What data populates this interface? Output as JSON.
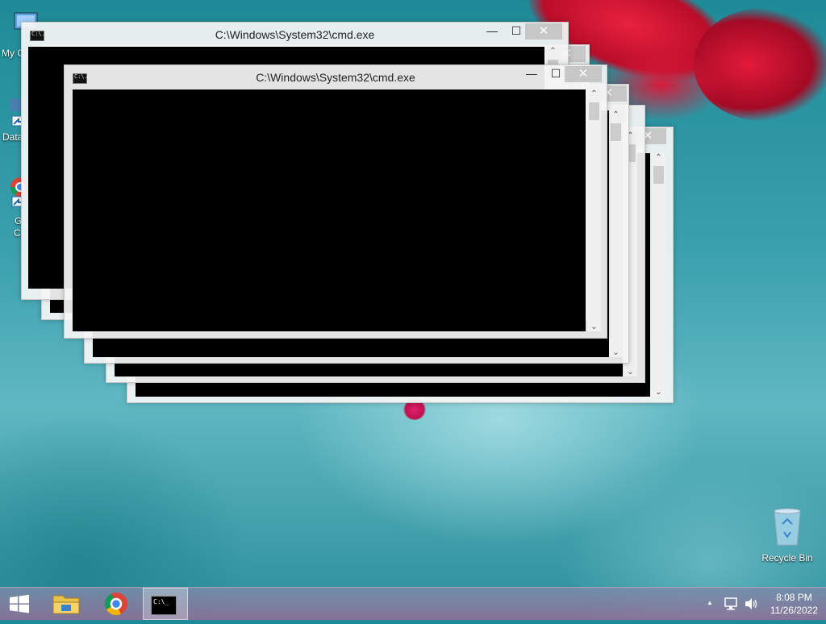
{
  "desktop": {
    "icons": [
      {
        "name": "my-computer",
        "label": "My C",
        "icon": "computer-icon"
      },
      {
        "name": "data",
        "label": "Data",
        "icon": "shortcut-icon"
      },
      {
        "name": "google-chrome",
        "label_line1": "G",
        "label_line2": "C",
        "icon": "chrome-icon"
      },
      {
        "name": "recycle-bin",
        "label": "Recycle Bin",
        "icon": "recycle-bin-icon"
      }
    ]
  },
  "windows": [
    {
      "title": "C:\\Windows\\System32\\cmd.exe",
      "min_label": "—",
      "max_label": "☐",
      "close_label": "✕",
      "icon_text": "C:\\."
    },
    {
      "title": "C:\\Windows\\System32\\cmd.exe",
      "min_label": "—",
      "max_label": "☐",
      "close_label": "✕",
      "icon_text": "C:\\."
    },
    {
      "title": "C:\\Windows\\System32\\cmd.exe",
      "min_label": "—",
      "max_label": "☐",
      "close_label": "✕",
      "icon_text": "C:\\."
    },
    {
      "title": "",
      "min_label": "",
      "max_label": "☐",
      "close_label": "✕"
    },
    {
      "title": "",
      "min_label": "",
      "max_label": "☐",
      "close_label": "✕"
    },
    {
      "title": "",
      "min_label": "",
      "max_label": "☐",
      "close_label": "✕"
    }
  ],
  "taskbar": {
    "start_icon": "windows-logo-icon",
    "pinned": [
      {
        "name": "file-explorer",
        "icon": "folder-icon"
      },
      {
        "name": "chrome",
        "icon": "chrome-icon"
      },
      {
        "name": "cmd",
        "icon": "terminal-icon",
        "icon_text": "C:\\_"
      }
    ],
    "tray": {
      "up_arrow": "▲",
      "time": "8:08 PM",
      "date": "11/26/2022"
    }
  },
  "colors": {
    "console_bg": "#000000",
    "window_frame": "#f5f5f5",
    "close_button": "#c7c7c7"
  }
}
